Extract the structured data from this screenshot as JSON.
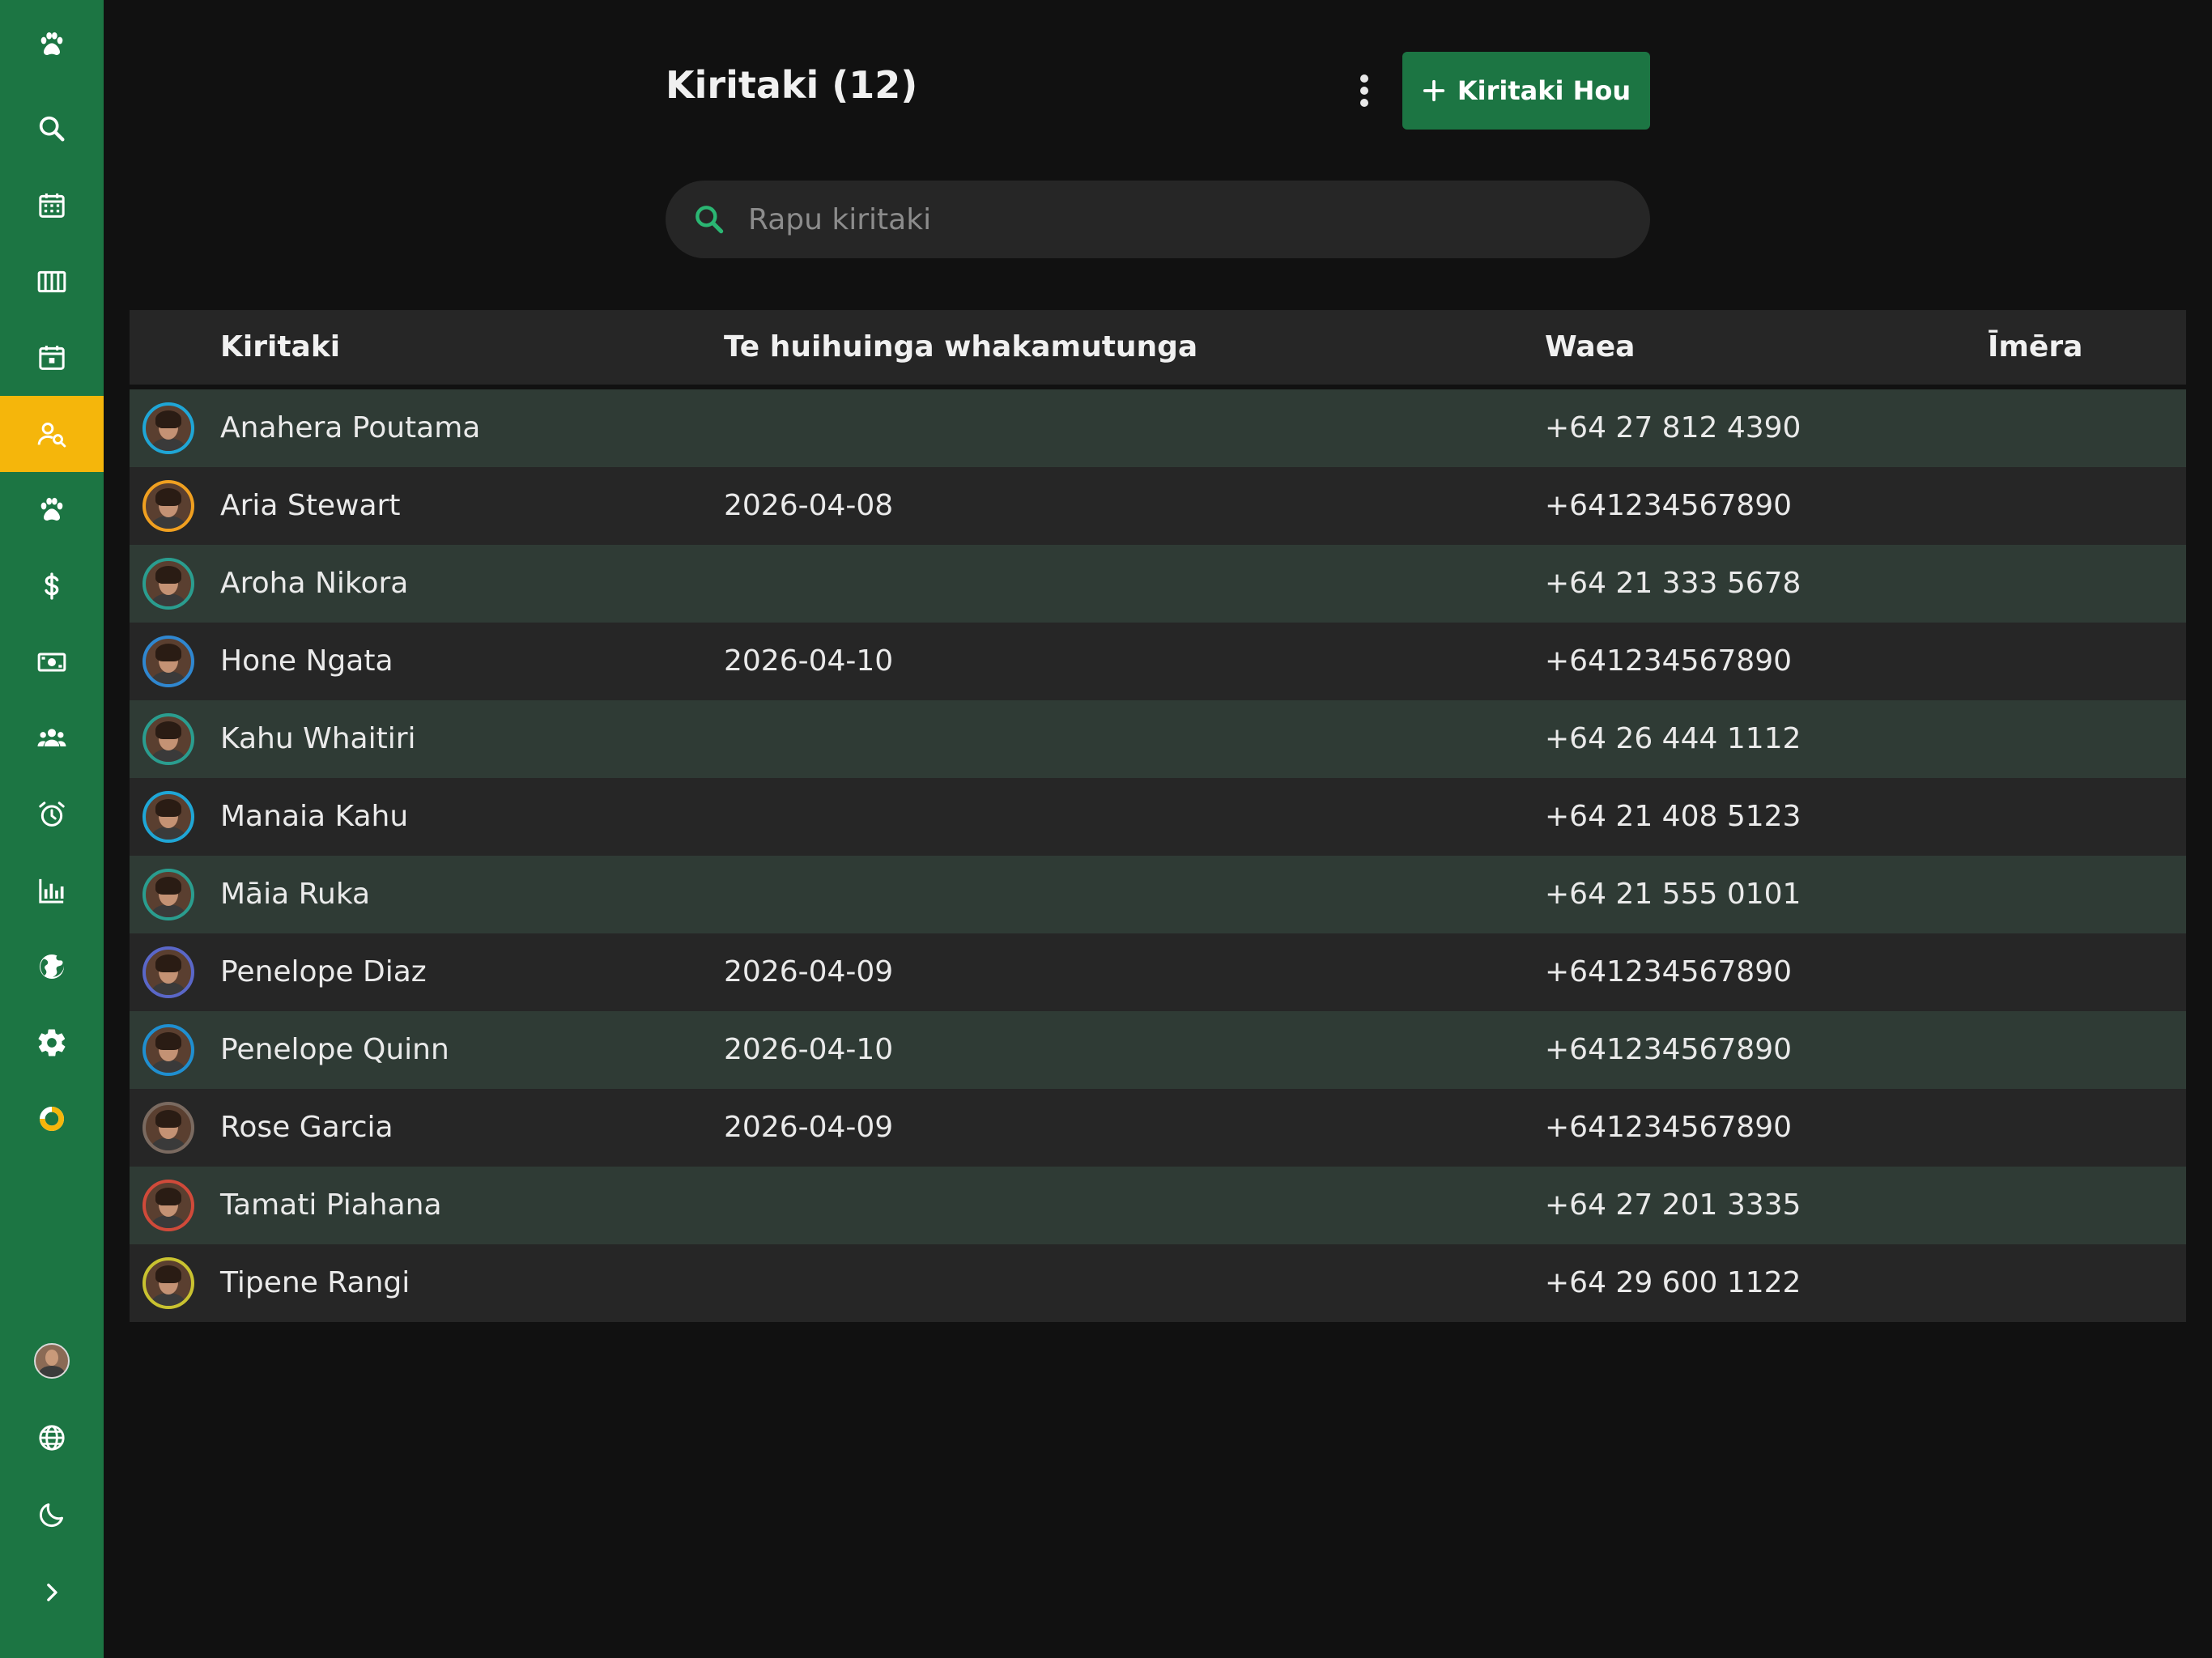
{
  "sidebar": {
    "items": [
      {
        "icon": "paw-icon",
        "label": ""
      },
      {
        "icon": "search-icon",
        "label": ""
      },
      {
        "icon": "calendar-grid-icon",
        "label": ""
      },
      {
        "icon": "columns-icon",
        "label": ""
      },
      {
        "icon": "calendar-day-icon",
        "label": ""
      },
      {
        "icon": "client-search-icon",
        "label": "",
        "active": true
      },
      {
        "icon": "paw-icon",
        "label": ""
      },
      {
        "icon": "dollar-icon",
        "label": ""
      },
      {
        "icon": "cash-icon",
        "label": ""
      },
      {
        "icon": "users-icon",
        "label": ""
      },
      {
        "icon": "alarm-icon",
        "label": ""
      },
      {
        "icon": "bar-chart-icon",
        "label": ""
      },
      {
        "icon": "globe-icon",
        "label": ""
      },
      {
        "icon": "gear-icon",
        "label": ""
      },
      {
        "icon": "donut-icon",
        "label": ""
      }
    ],
    "bottom": [
      {
        "icon": "user-avatar"
      },
      {
        "icon": "language-icon"
      },
      {
        "icon": "moon-icon"
      },
      {
        "icon": "chevron-right-icon"
      }
    ]
  },
  "header": {
    "title": "Kiritaki (12)",
    "new_button_label": "Kiritaki Hou"
  },
  "search": {
    "placeholder": "Rapu kiritaki",
    "value": ""
  },
  "table": {
    "columns": [
      "Kiritaki",
      "Te huihuinga whakamutunga",
      "Waea",
      "Īmēra"
    ],
    "rows": [
      {
        "name": "Anahera Poutama",
        "last_meeting": "",
        "phone": "+64 27 812 4390",
        "email": ""
      },
      {
        "name": "Aria Stewart",
        "last_meeting": "2026-04-08",
        "phone": "+641234567890",
        "email": ""
      },
      {
        "name": "Aroha Nikora",
        "last_meeting": "",
        "phone": "+64 21 333 5678",
        "email": ""
      },
      {
        "name": "Hone Ngata",
        "last_meeting": "2026-04-10",
        "phone": "+641234567890",
        "email": ""
      },
      {
        "name": "Kahu Whaitiri",
        "last_meeting": "",
        "phone": "+64 26 444 1112",
        "email": ""
      },
      {
        "name": "Manaia Kahu",
        "last_meeting": "",
        "phone": "+64 21 408 5123",
        "email": ""
      },
      {
        "name": "Māia Ruka",
        "last_meeting": "",
        "phone": "+64 21 555 0101",
        "email": ""
      },
      {
        "name": "Penelope Diaz",
        "last_meeting": "2026-04-09",
        "phone": "+641234567890",
        "email": ""
      },
      {
        "name": "Penelope Quinn",
        "last_meeting": "2026-04-10",
        "phone": "+641234567890",
        "email": ""
      },
      {
        "name": "Rose Garcia",
        "last_meeting": "2026-04-09",
        "phone": "+641234567890",
        "email": ""
      },
      {
        "name": "Tamati Piahana",
        "last_meeting": "",
        "phone": "+64 27 201 3335",
        "email": ""
      },
      {
        "name": "Tipene Rangi",
        "last_meeting": "",
        "phone": "+64 29 600 1122",
        "email": ""
      }
    ]
  },
  "colors": {
    "sidebar": "#1c7543",
    "active": "#f5b60b",
    "primary_button": "#1c7543",
    "search_icon": "#2bb673",
    "row_highlight": "#2f3b35",
    "row_plain": "#262626",
    "background": "#111111"
  }
}
